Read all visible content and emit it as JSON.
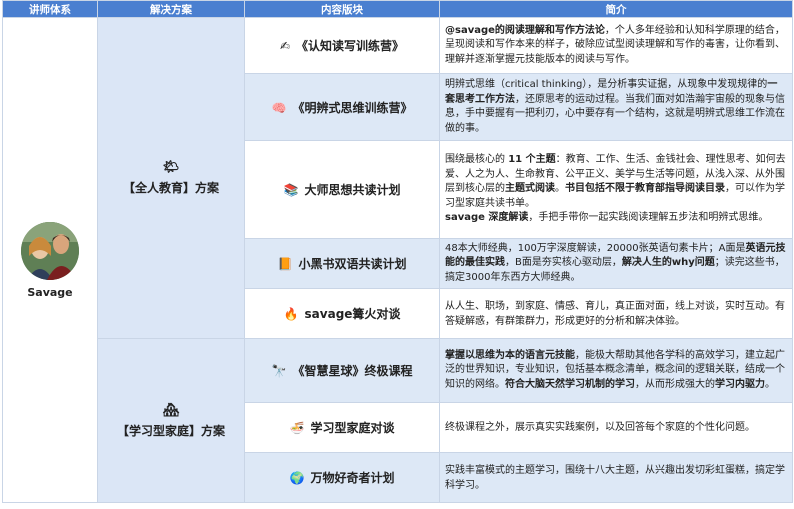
{
  "headers": [
    "讲师体系",
    "解决方案",
    "内容版块",
    "简介"
  ],
  "lecturer": {
    "name": "Savage"
  },
  "solutions": [
    {
      "icon": "sun-icon",
      "glyph": "🌤",
      "label": "【全人教育】方案"
    },
    {
      "icon": "house-icon",
      "glyph": "🏘",
      "label": "【学习型家庭】方案"
    }
  ],
  "rows": [
    {
      "module_icon": "writing-hand-icon",
      "glyph": "✍",
      "module": "《认知读写训练营》",
      "intro": [
        [
          "b",
          "@savage的阅读理解和写作方法论"
        ],
        [
          "t",
          "，个人多年经验和认知科学原理的结合，呈现阅读和写作本来的样子，破除应试型阅读理解和写作的毒害，让你看到、理解并逐渐掌握元技能版本的阅读与写作。"
        ]
      ]
    },
    {
      "module_icon": "brain-icon",
      "glyph": "🧠",
      "module": "《明辨式思维训练营》",
      "intro": [
        [
          "t",
          "明辨式思维（critical thinking），是分析事实证据，从现象中发现规律的"
        ],
        [
          "b",
          "一套思考工作方法"
        ],
        [
          "t",
          "，还原思考的运动过程。当我们面对如浩瀚宇宙般的现象与信息，手中要握有一把利刃，心中要存有一个结构，这就是明辨式思维工作流在做的事。"
        ]
      ]
    },
    {
      "module_icon": "books-icon",
      "glyph": "📚",
      "module": "大师思想共读计划",
      "intro": [
        [
          "t",
          "围绕最核心的 "
        ],
        [
          "b",
          "11 个主题"
        ],
        [
          "t",
          "：教育、工作、生活、金钱社会、理性思考、如何去爱、人之为人、生命教育、公平正义、美学与生活等问题，从浅入深、从外围层到核心层的"
        ],
        [
          "b",
          "主题式阅读"
        ],
        [
          "t",
          "。"
        ],
        [
          "b",
          "书目包括不限于教育部指导阅读目录"
        ],
        [
          "t",
          "，可以作为学习型家庭共读书单。"
        ],
        [
          "br",
          ""
        ],
        [
          "b",
          "savage 深度解读"
        ],
        [
          "t",
          "，手把手带你一起实践阅读理解五步法和明辨式思维。"
        ]
      ]
    },
    {
      "module_icon": "orange-book-icon",
      "glyph": "📙",
      "module": "小黑书双语共读计划",
      "intro": [
        [
          "t",
          "48本大师经典，100万字深度解读，20000张英语句素卡片；A面是"
        ],
        [
          "b",
          "英语元技能的最佳实践"
        ],
        [
          "t",
          "，B面是夯实核心驱动层，"
        ],
        [
          "b",
          "解决人生的why问题"
        ],
        [
          "t",
          "；读完这些书，搞定3000年东西方大师经典。"
        ]
      ]
    },
    {
      "module_icon": "fire-icon",
      "glyph": "🔥",
      "module": "savage篝火对谈",
      "intro": [
        [
          "t",
          "从人生、职场，到家庭、情感、育儿，真正面对面，线上对谈，实时互动。有答疑解惑，有群策群力，形成更好的分析和解决体验。"
        ]
      ]
    },
    {
      "module_icon": "telescope-icon",
      "glyph": "🔭",
      "module": "《智慧星球》终极课程",
      "intro": [
        [
          "b",
          "掌握以思维为本的语言元技能"
        ],
        [
          "t",
          "，能极大帮助其他各学科的高效学习，建立起广泛的世界知识，专业知识，包括基本概念清单，概念间的逻辑关联，结成一个知识的网络。"
        ],
        [
          "b",
          "符合大脑天然学习机制的学习"
        ],
        [
          "t",
          "，从而形成强大的"
        ],
        [
          "b",
          "学习内驱力"
        ],
        [
          "t",
          "。"
        ]
      ]
    },
    {
      "module_icon": "family-bowl-icon",
      "glyph": "🍜",
      "module": "学习型家庭对谈",
      "intro": [
        [
          "t",
          "终极课程之外，展示真实实践案例，以及回答每个家庭的个性化问题。"
        ]
      ]
    },
    {
      "module_icon": "globe-icon",
      "glyph": "🌍",
      "module": "万物好奇者计划",
      "intro": [
        [
          "t",
          "实践丰富模式的主题学习，围绕十八大主题，从兴趣出发切彩虹蛋糕，搞定学科学习。"
        ]
      ]
    }
  ]
}
